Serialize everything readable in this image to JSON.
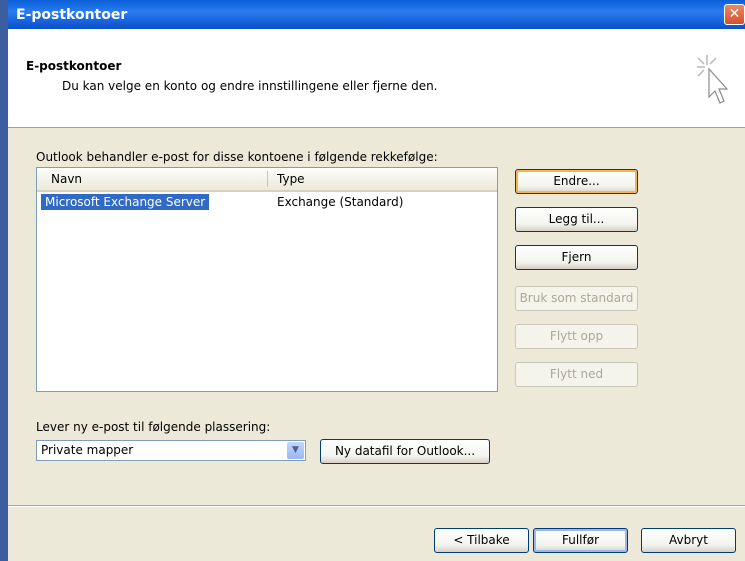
{
  "window": {
    "title": "E-postkontoer",
    "close_symbol": "✕"
  },
  "header": {
    "title": "E-postkontoer",
    "subtitle": "Du kan velge en konto og endre innstillingene eller fjerne den."
  },
  "accounts": {
    "label": "Outlook behandler e-post for disse kontoene i følgende rekkefølge:",
    "columns": [
      "Navn",
      "Type"
    ],
    "rows": [
      {
        "name": "Microsoft Exchange Server",
        "type": "Exchange (Standard)",
        "selected": true
      }
    ]
  },
  "side_buttons": {
    "change": "Endre...",
    "add": "Legg til...",
    "remove": "Fjern",
    "set_default": "Bruk som standard",
    "move_up": "Flytt opp",
    "move_down": "Flytt ned"
  },
  "delivery": {
    "label": "Lever ny e-post til følgende plassering:",
    "selected": "Private mapper",
    "new_datafile_button": "Ny datafil for Outlook..."
  },
  "footer": {
    "back": "< Tilbake",
    "finish": "Fullfør",
    "cancel": "Avbryt"
  },
  "colors": {
    "titlebar": "#0a5fd8",
    "selection": "#316ac5",
    "dialog_bg": "#ece9d8"
  }
}
